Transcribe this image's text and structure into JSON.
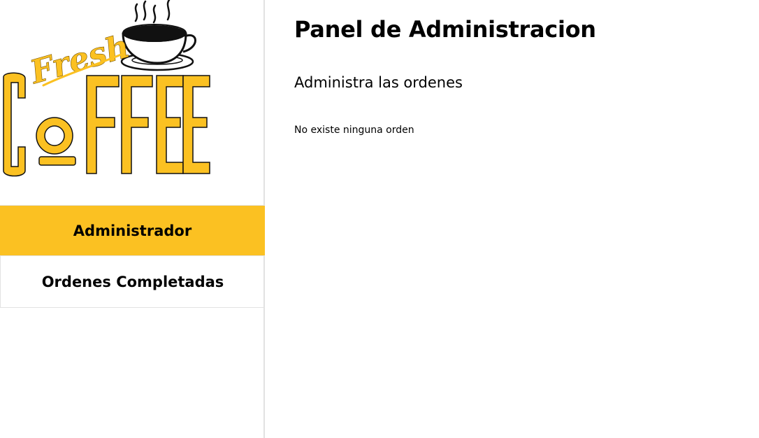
{
  "logo": {
    "top_word": "Fresh",
    "main_word": "COFFEE"
  },
  "colors": {
    "accent": "#fbc122",
    "border": "#e2e2e2",
    "text": "#000000"
  },
  "sidebar": {
    "items": [
      {
        "label": "Administrador",
        "active": true
      },
      {
        "label": "Ordenes Completadas",
        "active": false
      }
    ]
  },
  "main": {
    "title": "Panel de Administracion",
    "subtitle": "Administra las ordenes",
    "empty_message": "No existe ninguna orden"
  }
}
